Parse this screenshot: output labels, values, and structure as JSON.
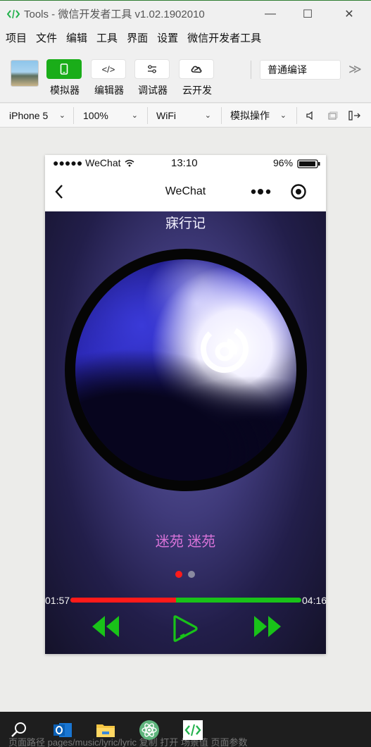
{
  "window": {
    "title": "Tools - 微信开发者工具 v1.02.1902010",
    "minimize_glyph": "—",
    "maximize_glyph": "☐",
    "close_glyph": "✕"
  },
  "menu": [
    "项目",
    "文件",
    "编辑",
    "工具",
    "界面",
    "设置",
    "微信开发者工具"
  ],
  "toolbar": {
    "simulator_label": "模拟器",
    "editor_label": "编辑器",
    "debugger_label": "调试器",
    "cloud_label": "云开发",
    "editor_glyph": "</>",
    "compile_mode": "普通编译",
    "more_glyph": "≫"
  },
  "device_bar": {
    "device": "iPhone 5",
    "zoom": "100%",
    "network": "WiFi",
    "action": "模拟操作",
    "chevron": "⌄"
  },
  "phone_status": {
    "carrier": "●●●●● WeChat",
    "time": "13:10",
    "battery": "96%",
    "battery_level": 0.96
  },
  "phone_nav": {
    "title": "WeChat",
    "back_glyph": "‹",
    "menu_glyph": "•••"
  },
  "player": {
    "song_title": "寐行记",
    "artist": "迷苑 迷苑",
    "current_time": "01:57",
    "total_time": "04:16",
    "progress": 0.457,
    "active_page": 0,
    "page_count": 2
  },
  "colors": {
    "progress_played": "#ff1a1a",
    "progress_remaining": "#19c219",
    "controls": "#19c219",
    "dot_active": "#ff1a1a",
    "dot_inactive": "#8a8aa0",
    "artist": "#d873d9"
  },
  "taskbar": {
    "behind_text": "页面路径   pages/music/lyric/lyric   复制   打开      场景值      页面参数",
    "icons": [
      "search-icon",
      "outlook-icon",
      "file-explorer-icon",
      "atom-icon",
      "wechat-devtools-icon"
    ]
  }
}
